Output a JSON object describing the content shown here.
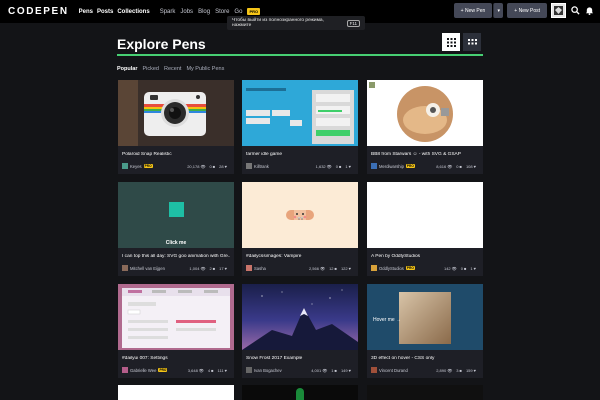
{
  "header": {
    "logo": "CODEPEN",
    "nav_main": [
      "Pens",
      "Posts",
      "Collections"
    ],
    "nav_secondary": [
      "Spark",
      "Jobs",
      "Blog",
      "Store",
      "Go"
    ],
    "pro_label": "PRO",
    "new_pen": "+ New Pen",
    "new_post": "+ New Post"
  },
  "toast": {
    "text": "Чтобы выйти из полноэкранного режима, нажмите",
    "key": "F11"
  },
  "page": {
    "title": "Explore Pens",
    "tabs": [
      "Popular",
      "Picked",
      "Recent",
      "My Public Pens"
    ]
  },
  "cards": [
    {
      "title": "Polaroid Snap Realistic",
      "author": "Keyes",
      "pro": "PRO",
      "views": "20,178",
      "comments": "0",
      "likes": "28"
    },
    {
      "title": "farmer idle game",
      "author": "Killtrank",
      "pro": "",
      "views": "1,632",
      "comments": "0",
      "likes": "1"
    },
    {
      "title": "BB8 from Starwars ☺ - with SVG & GSAP",
      "author": "Merdiwarship",
      "pro": "PRO",
      "views": "8,616",
      "comments": "0",
      "likes": "108"
    },
    {
      "title": "I can top this all day: SVG goo animation with Gre...",
      "author": "Mitchell van Eijgen",
      "pro": "",
      "views": "1,004",
      "comments": "2",
      "likes": "17"
    },
    {
      "title": "#dailycssimages: Vampire",
      "author": "Sasha",
      "pro": "",
      "views": "2,566",
      "comments": "12",
      "likes": "122"
    },
    {
      "title": "A Pen by OddlyStudios",
      "author": "OddlyStudios",
      "pro": "PRO",
      "views": "142",
      "comments": "0",
      "likes": "1"
    },
    {
      "title": "#dailyui 007: Settings",
      "author": "Gabrielle Wee",
      "pro": "PRO",
      "views": "3,648",
      "comments": "4",
      "likes": "111"
    },
    {
      "title": "Snow Frost 2017 Example",
      "author": "Ivan Bogachev",
      "pro": "",
      "views": "4,001",
      "comments": "1",
      "likes": "149"
    },
    {
      "title": "3D effect on hover - CSS only",
      "author": "Vincent Durand",
      "pro": "",
      "views": "2,890",
      "comments": "3",
      "likes": "159"
    }
  ],
  "thumb_text": {
    "click_me": "Click me",
    "hover_me": "Hover me →"
  },
  "colors": {
    "accent": "#47cf73",
    "card_bg": "#1e1f26",
    "page_bg": "#131417"
  }
}
